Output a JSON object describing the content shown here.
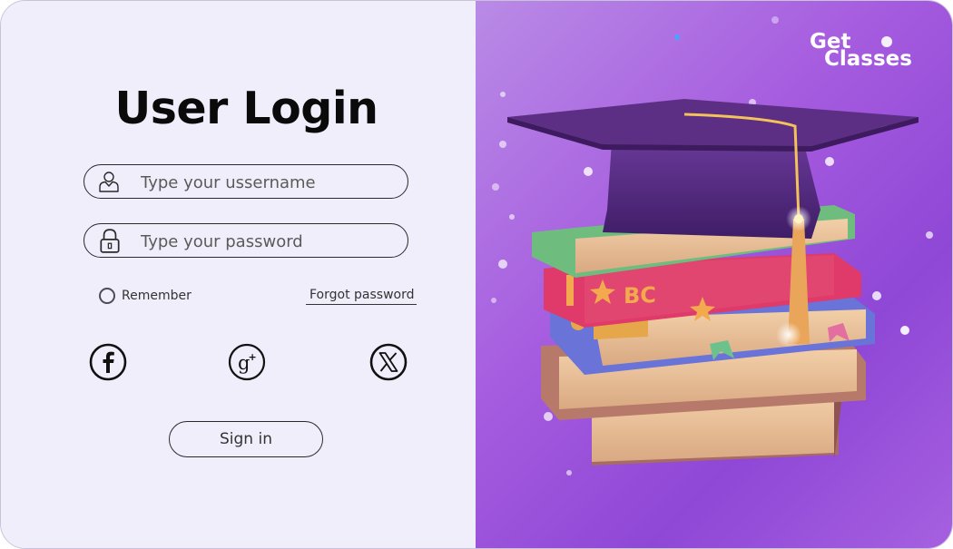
{
  "login": {
    "title": "User Login",
    "username_placeholder": "Type your ussername",
    "password_placeholder": "Type your password",
    "remember_label": "Remember",
    "forgot_label": "Forgot password",
    "signin_label": "Sign in",
    "social": [
      "facebook-icon",
      "google-plus-icon",
      "x-icon"
    ]
  },
  "brand": {
    "line1": "Get",
    "line2": "Classes"
  },
  "illustration": {
    "book_spine_text": "BC",
    "colors": {
      "panel": "#f1eefb",
      "accent": "#a65cdf"
    }
  }
}
